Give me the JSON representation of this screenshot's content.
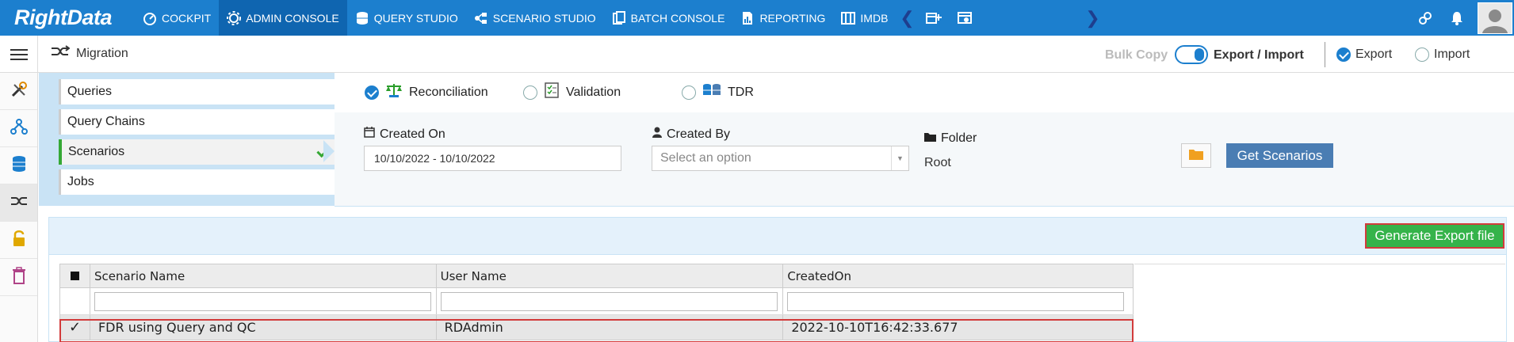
{
  "app": {
    "logo_text": "RightData",
    "brand_color": "#1c7fce",
    "active_nav_color": "#0f65b0"
  },
  "nav": {
    "items": [
      {
        "label": "COCKPIT",
        "icon": "gauge-icon"
      },
      {
        "label": "ADMIN CONSOLE",
        "icon": "gear-icon",
        "active": true
      },
      {
        "label": "QUERY STUDIO",
        "icon": "database-icon"
      },
      {
        "label": "SCENARIO STUDIO",
        "icon": "flow-icon"
      },
      {
        "label": "BATCH CONSOLE",
        "icon": "batch-icon"
      },
      {
        "label": "REPORTING",
        "icon": "report-icon"
      },
      {
        "label": "IMDB",
        "icon": "book-icon"
      }
    ]
  },
  "subheader": {
    "title": "Migration",
    "bulk_copy": "Bulk Copy",
    "export_import": "Export / Import",
    "export_label": "Export",
    "import_label": "Import",
    "selected_mode": "Export"
  },
  "categories": {
    "items": [
      {
        "label": "Queries"
      },
      {
        "label": "Query Chains"
      },
      {
        "label": "Scenarios",
        "active": true
      },
      {
        "label": "Jobs"
      }
    ]
  },
  "types": {
    "reconciliation": "Reconciliation",
    "validation": "Validation",
    "tdr": "TDR",
    "selected": "Reconciliation"
  },
  "filters": {
    "created_on_label": "Created On",
    "created_on_value": "10/10/2022 - 10/10/2022",
    "created_by_label": "Created By",
    "created_by_placeholder": "Select an option",
    "folder_label": "Folder",
    "folder_value": "Root",
    "get_button": "Get Scenarios"
  },
  "grid": {
    "generate_button": "Generate Export file",
    "columns": [
      "Scenario Name",
      "User Name",
      "CreatedOn"
    ],
    "rows": [
      {
        "checked": "✓",
        "scenario_name": "FDR using Query and QC",
        "user_name": "RDAdmin",
        "created_on": "2022-10-10T16:42:33.677"
      }
    ]
  }
}
